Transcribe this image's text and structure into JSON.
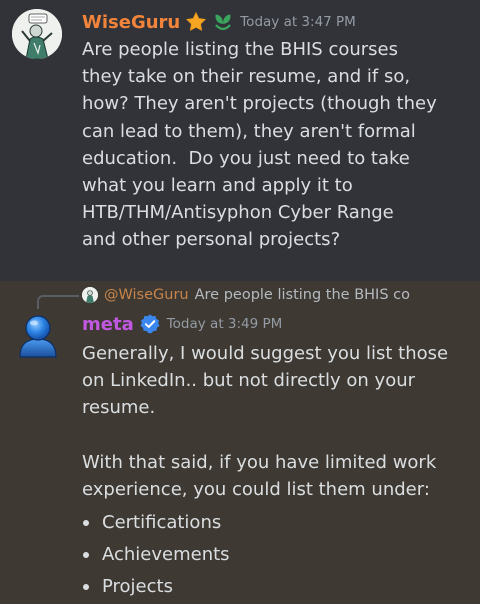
{
  "colors": {
    "background_top": "#313338",
    "background_highlight": "#3e3a33",
    "author1": "#f2843b",
    "author2": "#c158e0",
    "text": "#dbdee1",
    "muted": "#949ba4"
  },
  "messages": [
    {
      "author": "WiseGuru",
      "author_icons": [
        "star-icon",
        "leaf-badge-icon"
      ],
      "timestamp": "Today at 3:47 PM",
      "lines": [
        "Are people listing the BHIS courses",
        "they take on their resume, and if so,",
        "how? They aren't projects (though they",
        "can lead to them), they aren't formal",
        "education.  Do you just need to take",
        "what you learn and apply it to",
        "HTB/THM/Antisyphon Cyber Range",
        "and other personal projects?"
      ]
    },
    {
      "reply": {
        "mention": "@WiseGuru",
        "preview": "Are people listing the BHIS co"
      },
      "author": "meta",
      "author_icons": [
        "verified-check-icon"
      ],
      "timestamp": "Today at 3:49 PM",
      "paragraph1": [
        "Generally, I would suggest you list those",
        "on LinkedIn.. but not directly on your",
        "resume."
      ],
      "paragraph2": [
        "With that said, if you have limited work",
        "experience, you could list them under:"
      ],
      "bullets": [
        "Certifications",
        "Achievements",
        "Projects"
      ]
    }
  ]
}
